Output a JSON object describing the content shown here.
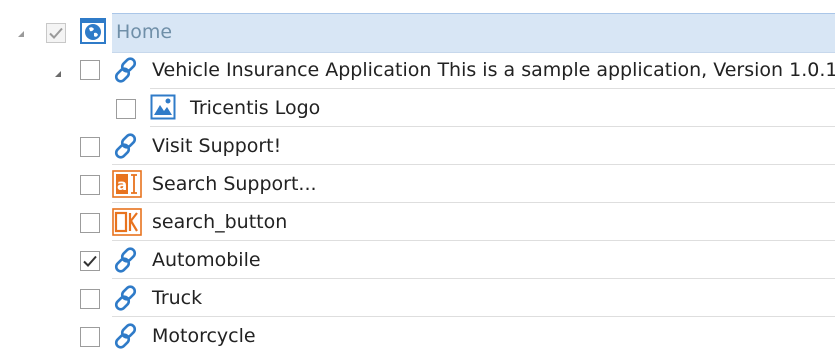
{
  "tree": {
    "home": {
      "label": "Home",
      "checked": true,
      "icon": "globe-page-icon"
    },
    "app": {
      "label": "Vehicle Insurance Application This is a sample application, Version 1.0.1",
      "icon": "link-icon",
      "children": [
        {
          "label": "Tricentis Logo",
          "icon": "image-icon",
          "checked": false
        }
      ]
    },
    "items": [
      {
        "label": "Visit Support!",
        "icon": "link-icon",
        "checked": false
      },
      {
        "label": "Search Support...",
        "icon": "text-field-icon",
        "checked": false
      },
      {
        "label": "search_button",
        "icon": "ok-button-icon",
        "checked": false
      },
      {
        "label": "Automobile",
        "icon": "link-icon",
        "checked": true
      },
      {
        "label": "Truck",
        "icon": "link-icon",
        "checked": false
      },
      {
        "label": "Motorcycle",
        "icon": "link-icon",
        "checked": false
      }
    ]
  },
  "colors": {
    "selection_bg": "#d8e6f5",
    "icon_blue": "#2f7bc8",
    "icon_orange": "#e8731e"
  }
}
